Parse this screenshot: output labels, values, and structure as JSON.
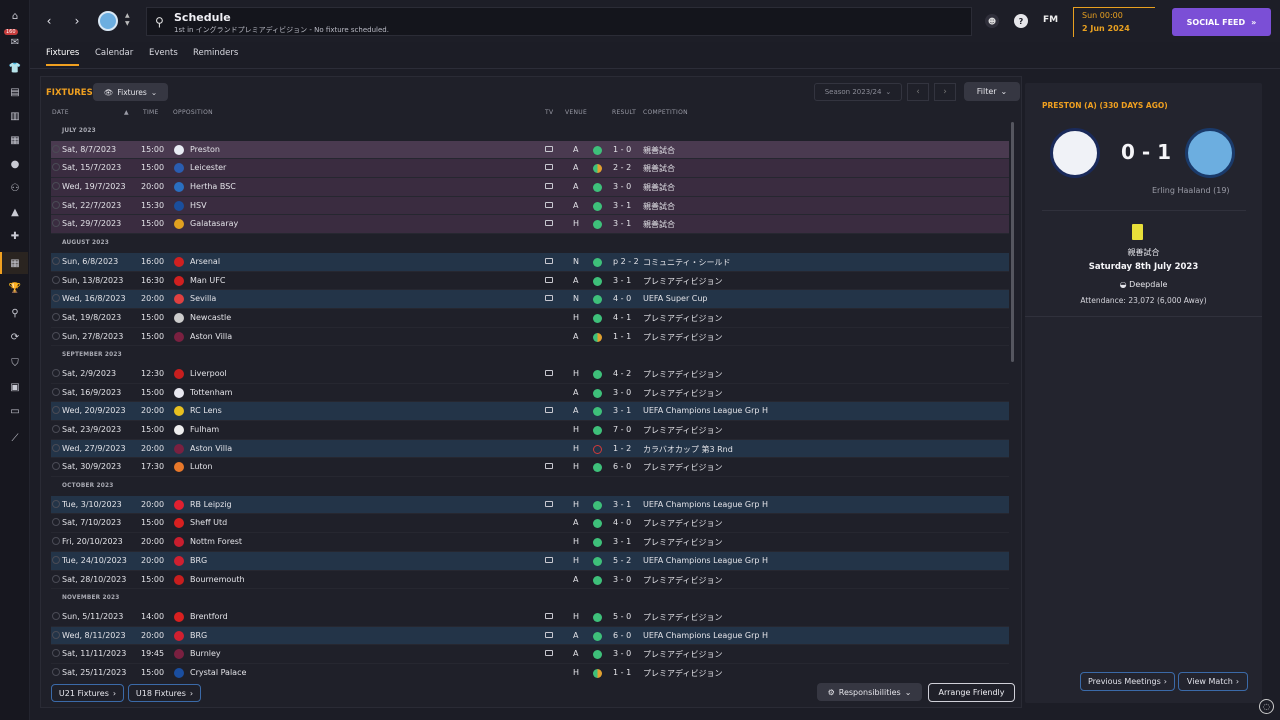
{
  "sidebar": {
    "badge": "160"
  },
  "header": {
    "title": "Schedule",
    "subtitle": "1st in イングランドプレミアディビジョン - No fixture scheduled.",
    "fm_label": "FM",
    "date_time": "Sun 00:00",
    "date": "2 Jun 2024",
    "social_feed": "SOCIAL FEED"
  },
  "tabs": [
    {
      "label": "Fixtures"
    },
    {
      "label": "Calendar"
    },
    {
      "label": "Events"
    },
    {
      "label": "Reminders"
    }
  ],
  "panel": {
    "title": "FIXTURES",
    "dropdown": "Fixtures",
    "season": "Season 2023/24",
    "filter": "Filter"
  },
  "columns": {
    "date": "DATE",
    "time": "TIME",
    "opposition": "OPPOSITION",
    "tv": "TV",
    "venue": "VENUE",
    "result": "RESULT",
    "competition": "COMPETITION"
  },
  "months": [
    {
      "label": "JULY 2023",
      "rows": [
        {
          "date": "Sat, 8/7/2023",
          "time": "15:00",
          "opp": "Preston",
          "crest": "#e8ecf4",
          "tv": true,
          "venue": "A",
          "outcome": "win",
          "result": "1 - 0",
          "comp": "親善試合",
          "hl": "sel"
        },
        {
          "date": "Sat, 15/7/2023",
          "time": "15:00",
          "opp": "Leicester",
          "crest": "#2a5db0",
          "tv": true,
          "venue": "A",
          "outcome": "draw",
          "result": "2 - 2",
          "comp": "親善試合",
          "hl": "p"
        },
        {
          "date": "Wed, 19/7/2023",
          "time": "20:00",
          "opp": "Hertha BSC",
          "crest": "#2a6fc0",
          "tv": true,
          "venue": "A",
          "outcome": "win",
          "result": "3 - 0",
          "comp": "親善試合",
          "hl": "p"
        },
        {
          "date": "Sat, 22/7/2023",
          "time": "15:30",
          "opp": "HSV",
          "crest": "#1a4e9c",
          "tv": true,
          "venue": "A",
          "outcome": "win",
          "result": "3 - 1",
          "comp": "親善試合",
          "hl": "p"
        },
        {
          "date": "Sat, 29/7/2023",
          "time": "15:00",
          "opp": "Galatasaray",
          "crest": "#e0a020",
          "tv": true,
          "venue": "H",
          "outcome": "win",
          "result": "3 - 1",
          "comp": "親善試合",
          "hl": "p"
        }
      ]
    },
    {
      "label": "AUGUST 2023",
      "rows": [
        {
          "date": "Sun, 6/8/2023",
          "time": "16:00",
          "opp": "Arsenal",
          "crest": "#d02020",
          "tv": true,
          "venue": "N",
          "outcome": "win",
          "result": "p 2 - 2",
          "comp": "コミュニティ・シールド",
          "hl": "b"
        },
        {
          "date": "Sun, 13/8/2023",
          "time": "16:30",
          "opp": "Man UFC",
          "crest": "#d02020",
          "tv": true,
          "venue": "A",
          "outcome": "win",
          "result": "3 - 1",
          "comp": "プレミアディビジョン",
          "hl": ""
        },
        {
          "date": "Wed, 16/8/2023",
          "time": "20:00",
          "opp": "Sevilla",
          "crest": "#e04040",
          "tv": true,
          "venue": "N",
          "outcome": "win",
          "result": "4 - 0",
          "comp": "UEFA Super Cup",
          "hl": "b"
        },
        {
          "date": "Sat, 19/8/2023",
          "time": "15:00",
          "opp": "Newcastle",
          "crest": "#cccccc",
          "tv": false,
          "venue": "H",
          "outcome": "win",
          "result": "4 - 1",
          "comp": "プレミアディビジョン",
          "hl": ""
        },
        {
          "date": "Sun, 27/8/2023",
          "time": "15:00",
          "opp": "Aston Villa",
          "crest": "#7a2040",
          "tv": false,
          "venue": "A",
          "outcome": "draw",
          "result": "1 - 1",
          "comp": "プレミアディビジョン",
          "hl": ""
        }
      ]
    },
    {
      "label": "SEPTEMBER 2023",
      "rows": [
        {
          "date": "Sat, 2/9/2023",
          "time": "12:30",
          "opp": "Liverpool",
          "crest": "#c81e1e",
          "tv": true,
          "venue": "H",
          "outcome": "win",
          "result": "4 - 2",
          "comp": "プレミアディビジョン",
          "hl": ""
        },
        {
          "date": "Sat, 16/9/2023",
          "time": "15:00",
          "opp": "Tottenham",
          "crest": "#e8e8f0",
          "tv": false,
          "venue": "A",
          "outcome": "win",
          "result": "3 - 0",
          "comp": "プレミアディビジョン",
          "hl": ""
        },
        {
          "date": "Wed, 20/9/2023",
          "time": "20:00",
          "opp": "RC Lens",
          "crest": "#e8c020",
          "tv": true,
          "venue": "A",
          "outcome": "win",
          "result": "3 - 1",
          "comp": "UEFA Champions League Grp H",
          "hl": "b"
        },
        {
          "date": "Sat, 23/9/2023",
          "time": "15:00",
          "opp": "Fulham",
          "crest": "#eeeeee",
          "tv": false,
          "venue": "H",
          "outcome": "win",
          "result": "7 - 0",
          "comp": "プレミアディビジョン",
          "hl": ""
        },
        {
          "date": "Wed, 27/9/2023",
          "time": "20:00",
          "opp": "Aston Villa",
          "crest": "#7a2040",
          "tv": false,
          "venue": "H",
          "outcome": "loss",
          "result": "1 - 2",
          "comp": "カラバオカップ 第3 Rnd",
          "hl": "b"
        },
        {
          "date": "Sat, 30/9/2023",
          "time": "17:30",
          "opp": "Luton",
          "crest": "#e8782a",
          "tv": true,
          "venue": "H",
          "outcome": "win",
          "result": "6 - 0",
          "comp": "プレミアディビジョン",
          "hl": ""
        }
      ]
    },
    {
      "label": "OCTOBER 2023",
      "rows": [
        {
          "date": "Tue, 3/10/2023",
          "time": "20:00",
          "opp": "RB Leipzig",
          "crest": "#e02030",
          "tv": true,
          "venue": "H",
          "outcome": "win",
          "result": "3 - 1",
          "comp": "UEFA Champions League Grp H",
          "hl": "b"
        },
        {
          "date": "Sat, 7/10/2023",
          "time": "15:00",
          "opp": "Sheff Utd",
          "crest": "#d82020",
          "tv": false,
          "venue": "A",
          "outcome": "win",
          "result": "4 - 0",
          "comp": "プレミアディビジョン",
          "hl": ""
        },
        {
          "date": "Fri, 20/10/2023",
          "time": "20:00",
          "opp": "Nottm Forest",
          "crest": "#c81e2e",
          "tv": false,
          "venue": "H",
          "outcome": "win",
          "result": "3 - 1",
          "comp": "プレミアディビジョン",
          "hl": ""
        },
        {
          "date": "Tue, 24/10/2023",
          "time": "20:00",
          "opp": "BRG",
          "crest": "#d02030",
          "tv": true,
          "venue": "H",
          "outcome": "win",
          "result": "5 - 2",
          "comp": "UEFA Champions League Grp H",
          "hl": "b"
        },
        {
          "date": "Sat, 28/10/2023",
          "time": "15:00",
          "opp": "Bournemouth",
          "crest": "#c81e1e",
          "tv": false,
          "venue": "A",
          "outcome": "win",
          "result": "3 - 0",
          "comp": "プレミアディビジョン",
          "hl": ""
        }
      ]
    },
    {
      "label": "NOVEMBER 2023",
      "rows": [
        {
          "date": "Sun, 5/11/2023",
          "time": "14:00",
          "opp": "Brentford",
          "crest": "#d82020",
          "tv": true,
          "venue": "H",
          "outcome": "win",
          "result": "5 - 0",
          "comp": "プレミアディビジョン",
          "hl": ""
        },
        {
          "date": "Wed, 8/11/2023",
          "time": "20:00",
          "opp": "BRG",
          "crest": "#d02030",
          "tv": true,
          "venue": "A",
          "outcome": "win",
          "result": "6 - 0",
          "comp": "UEFA Champions League Grp H",
          "hl": "b"
        },
        {
          "date": "Sat, 11/11/2023",
          "time": "19:45",
          "opp": "Burnley",
          "crest": "#7a2040",
          "tv": true,
          "venue": "A",
          "outcome": "win",
          "result": "3 - 0",
          "comp": "プレミアディビジョン",
          "hl": ""
        },
        {
          "date": "Sat, 25/11/2023",
          "time": "15:00",
          "opp": "Crystal Palace",
          "crest": "#1a4ea0",
          "tv": false,
          "venue": "H",
          "outcome": "draw",
          "result": "1 - 1",
          "comp": "プレミアディビジョン",
          "hl": ""
        }
      ]
    }
  ],
  "bottom": {
    "u21": "U21 Fixtures",
    "u18": "U18 Fixtures",
    "responsibilities": "Responsibilities",
    "arrange": "Arrange Friendly"
  },
  "match_panel": {
    "title": "PRESTON (A) (330 DAYS AGO)",
    "score": "0 - 1",
    "scorer": "Erling Haaland (19)",
    "competition": "親善試合",
    "date": "Saturday 8th July 2023",
    "stadium": "Deepdale",
    "attendance": "Attendance: 23,072 (6,000 Away)",
    "prev": "Previous Meetings",
    "view": "View Match"
  },
  "colors": {
    "accent": "#f0a020",
    "win": "#3ec07a",
    "draw": "#e0a030",
    "loss": "#d03a3a",
    "social": "#7b4fd6"
  }
}
